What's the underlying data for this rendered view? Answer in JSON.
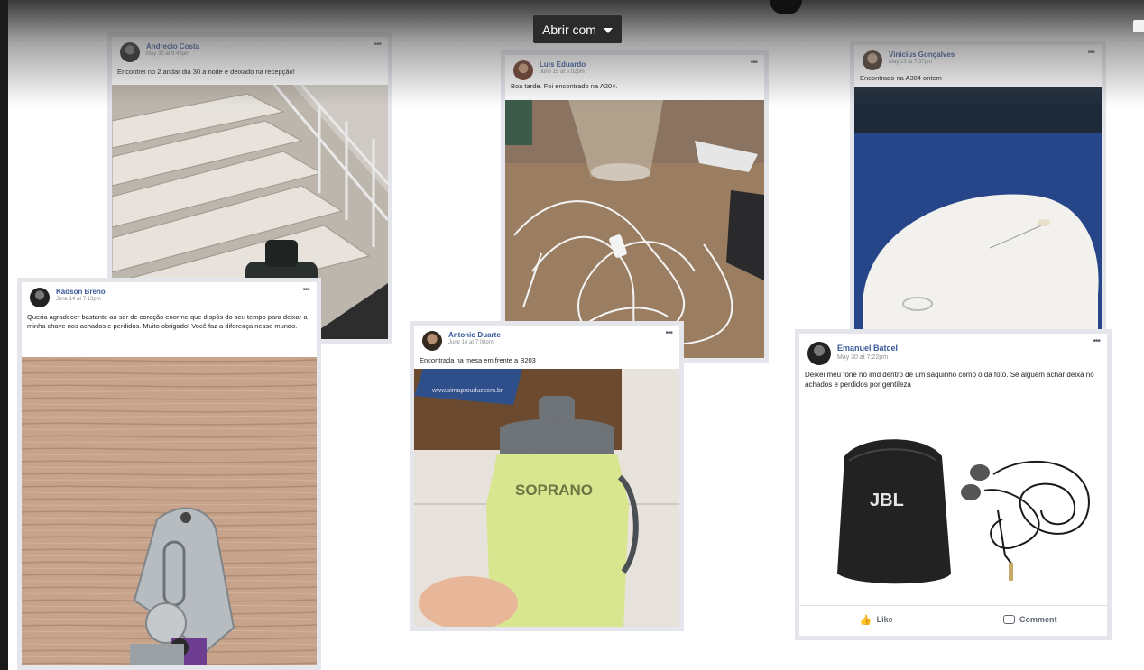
{
  "viewer": {
    "open_with_label": "Abrir com"
  },
  "posts": [
    {
      "name": "Andrecio Costa",
      "time": "May 30 at 9:49pm",
      "text": "Encontrei no 2 andar dia 30 a noite e deixado na recepção!"
    },
    {
      "name": "Luis Eduardo",
      "time": "June 15 at 5:02pm",
      "text": "Boa tarde. Foi encontrado na A204."
    },
    {
      "name": "Vinicius Gonçalves",
      "time": "May 23 at 7:37pm",
      "text": "Encontrado na A304 ontem"
    },
    {
      "name": "Kádson Breno",
      "time": "June 14 at 7:13pm",
      "text": "Queria agradecer bastante ao ser de coração enorme que dispôs do seu tempo para deixar a minha chave nos achados e perdidos. Muito obrigado! Você faz a diferença nesse mundo."
    },
    {
      "name": "Antonio Duarte",
      "time": "June 14 at 7:08pm",
      "text": "Encontrada na mesa em frente a B203"
    },
    {
      "name": "Emanuel Batcel",
      "time": "May 30 at 7:22pm",
      "text": "Deixei meu fone no imd dentro de um saquinho como o da foto. Se alguém achar deixa no achados e perdidos por gentileza",
      "like_label": "Like",
      "comment_label": "Comment"
    }
  ],
  "photo_text": {
    "jbl": "JBL",
    "bottle_brand": "SOPRANO",
    "note": "www.simaprouduzcom.br"
  },
  "icons": [
    "chevron-down-icon",
    "more-options-icon",
    "like-icon",
    "comment-icon"
  ]
}
